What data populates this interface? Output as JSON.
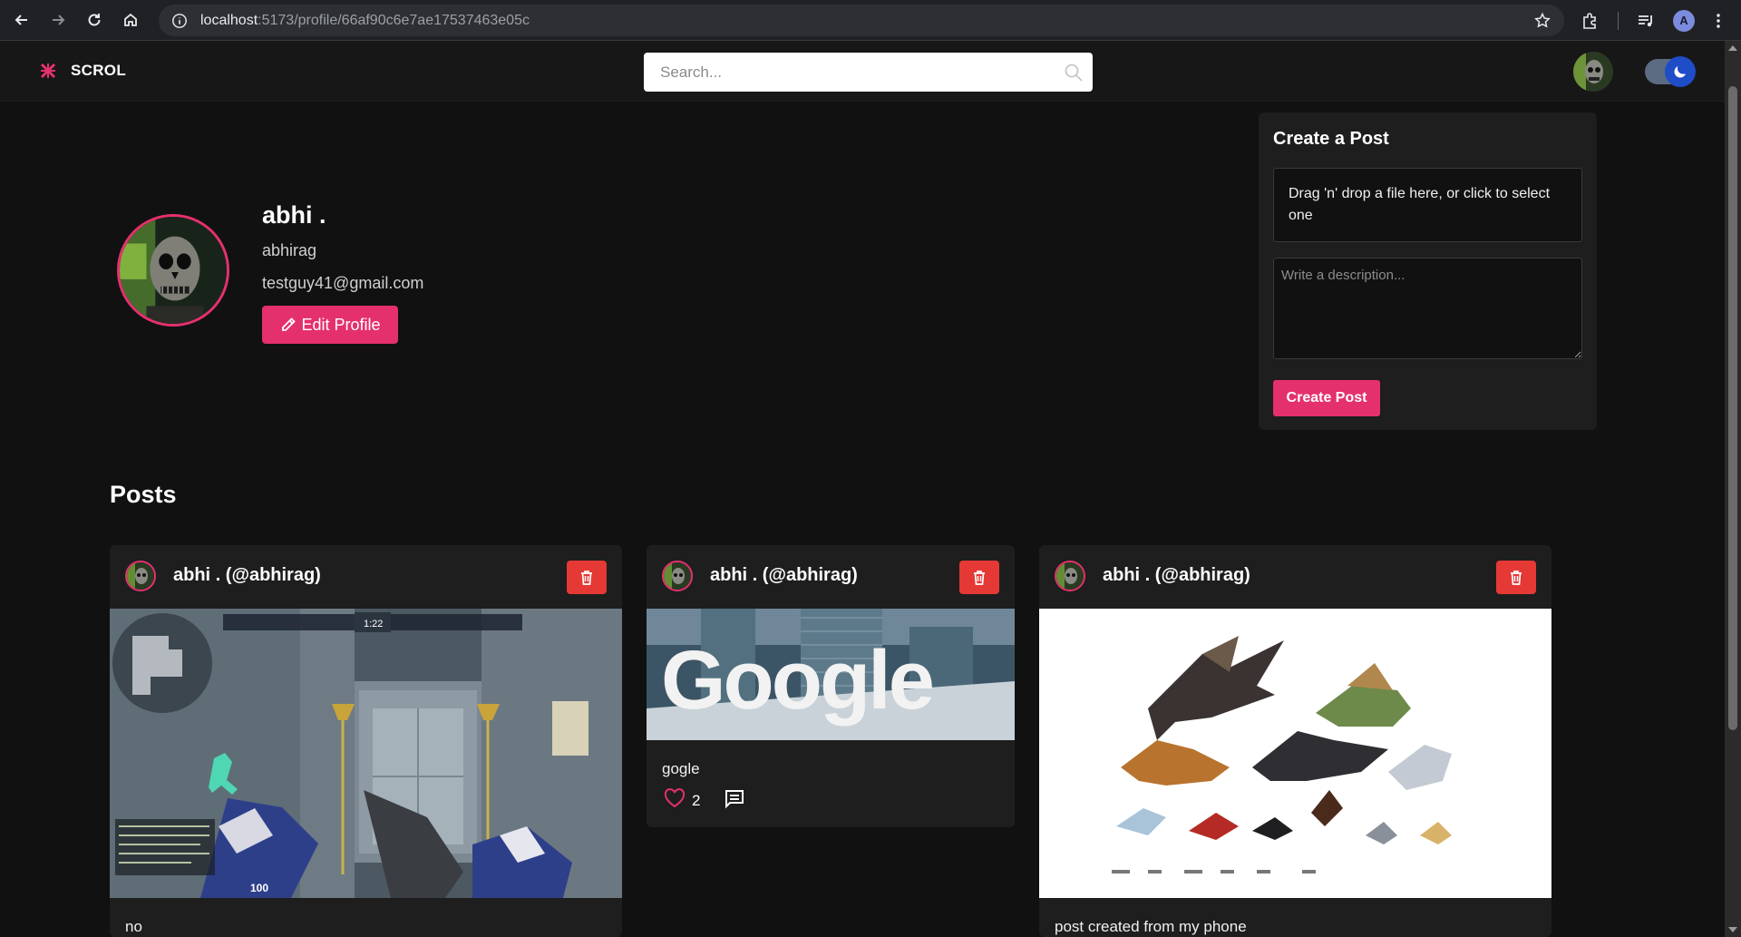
{
  "browser": {
    "url_host": "localhost",
    "url_path": ":5173/profile/66af90c6e7ae17537463e05c",
    "profile_initial": "A"
  },
  "header": {
    "brand": "SCROL",
    "search_placeholder": "Search..."
  },
  "profile": {
    "display_name": "abhi .",
    "username": "abhirag",
    "email": "testguy41@gmail.com",
    "edit_label": "Edit Profile"
  },
  "create_post": {
    "title": "Create a Post",
    "dropzone_text": "Drag 'n' drop a file here, or click to select one",
    "description_placeholder": "Write a description...",
    "submit_label": "Create Post"
  },
  "posts_section": {
    "heading": "Posts",
    "items": [
      {
        "author": "abhi . (@abhirag)",
        "caption": "no",
        "media": "game-screenshot"
      },
      {
        "author": "abhi . (@abhirag)",
        "caption": "gogle",
        "likes": "2",
        "media": "google-logo-image"
      },
      {
        "author": "abhi . (@abhirag)",
        "caption": "post created from my phone",
        "media": "dragons-chart-image"
      }
    ]
  },
  "game_hud": {
    "health": "100",
    "timer": "1:22"
  },
  "colors": {
    "accent": "#e5306e",
    "delete": "#e53935",
    "background": "#111111",
    "card": "#1e1e1e"
  }
}
